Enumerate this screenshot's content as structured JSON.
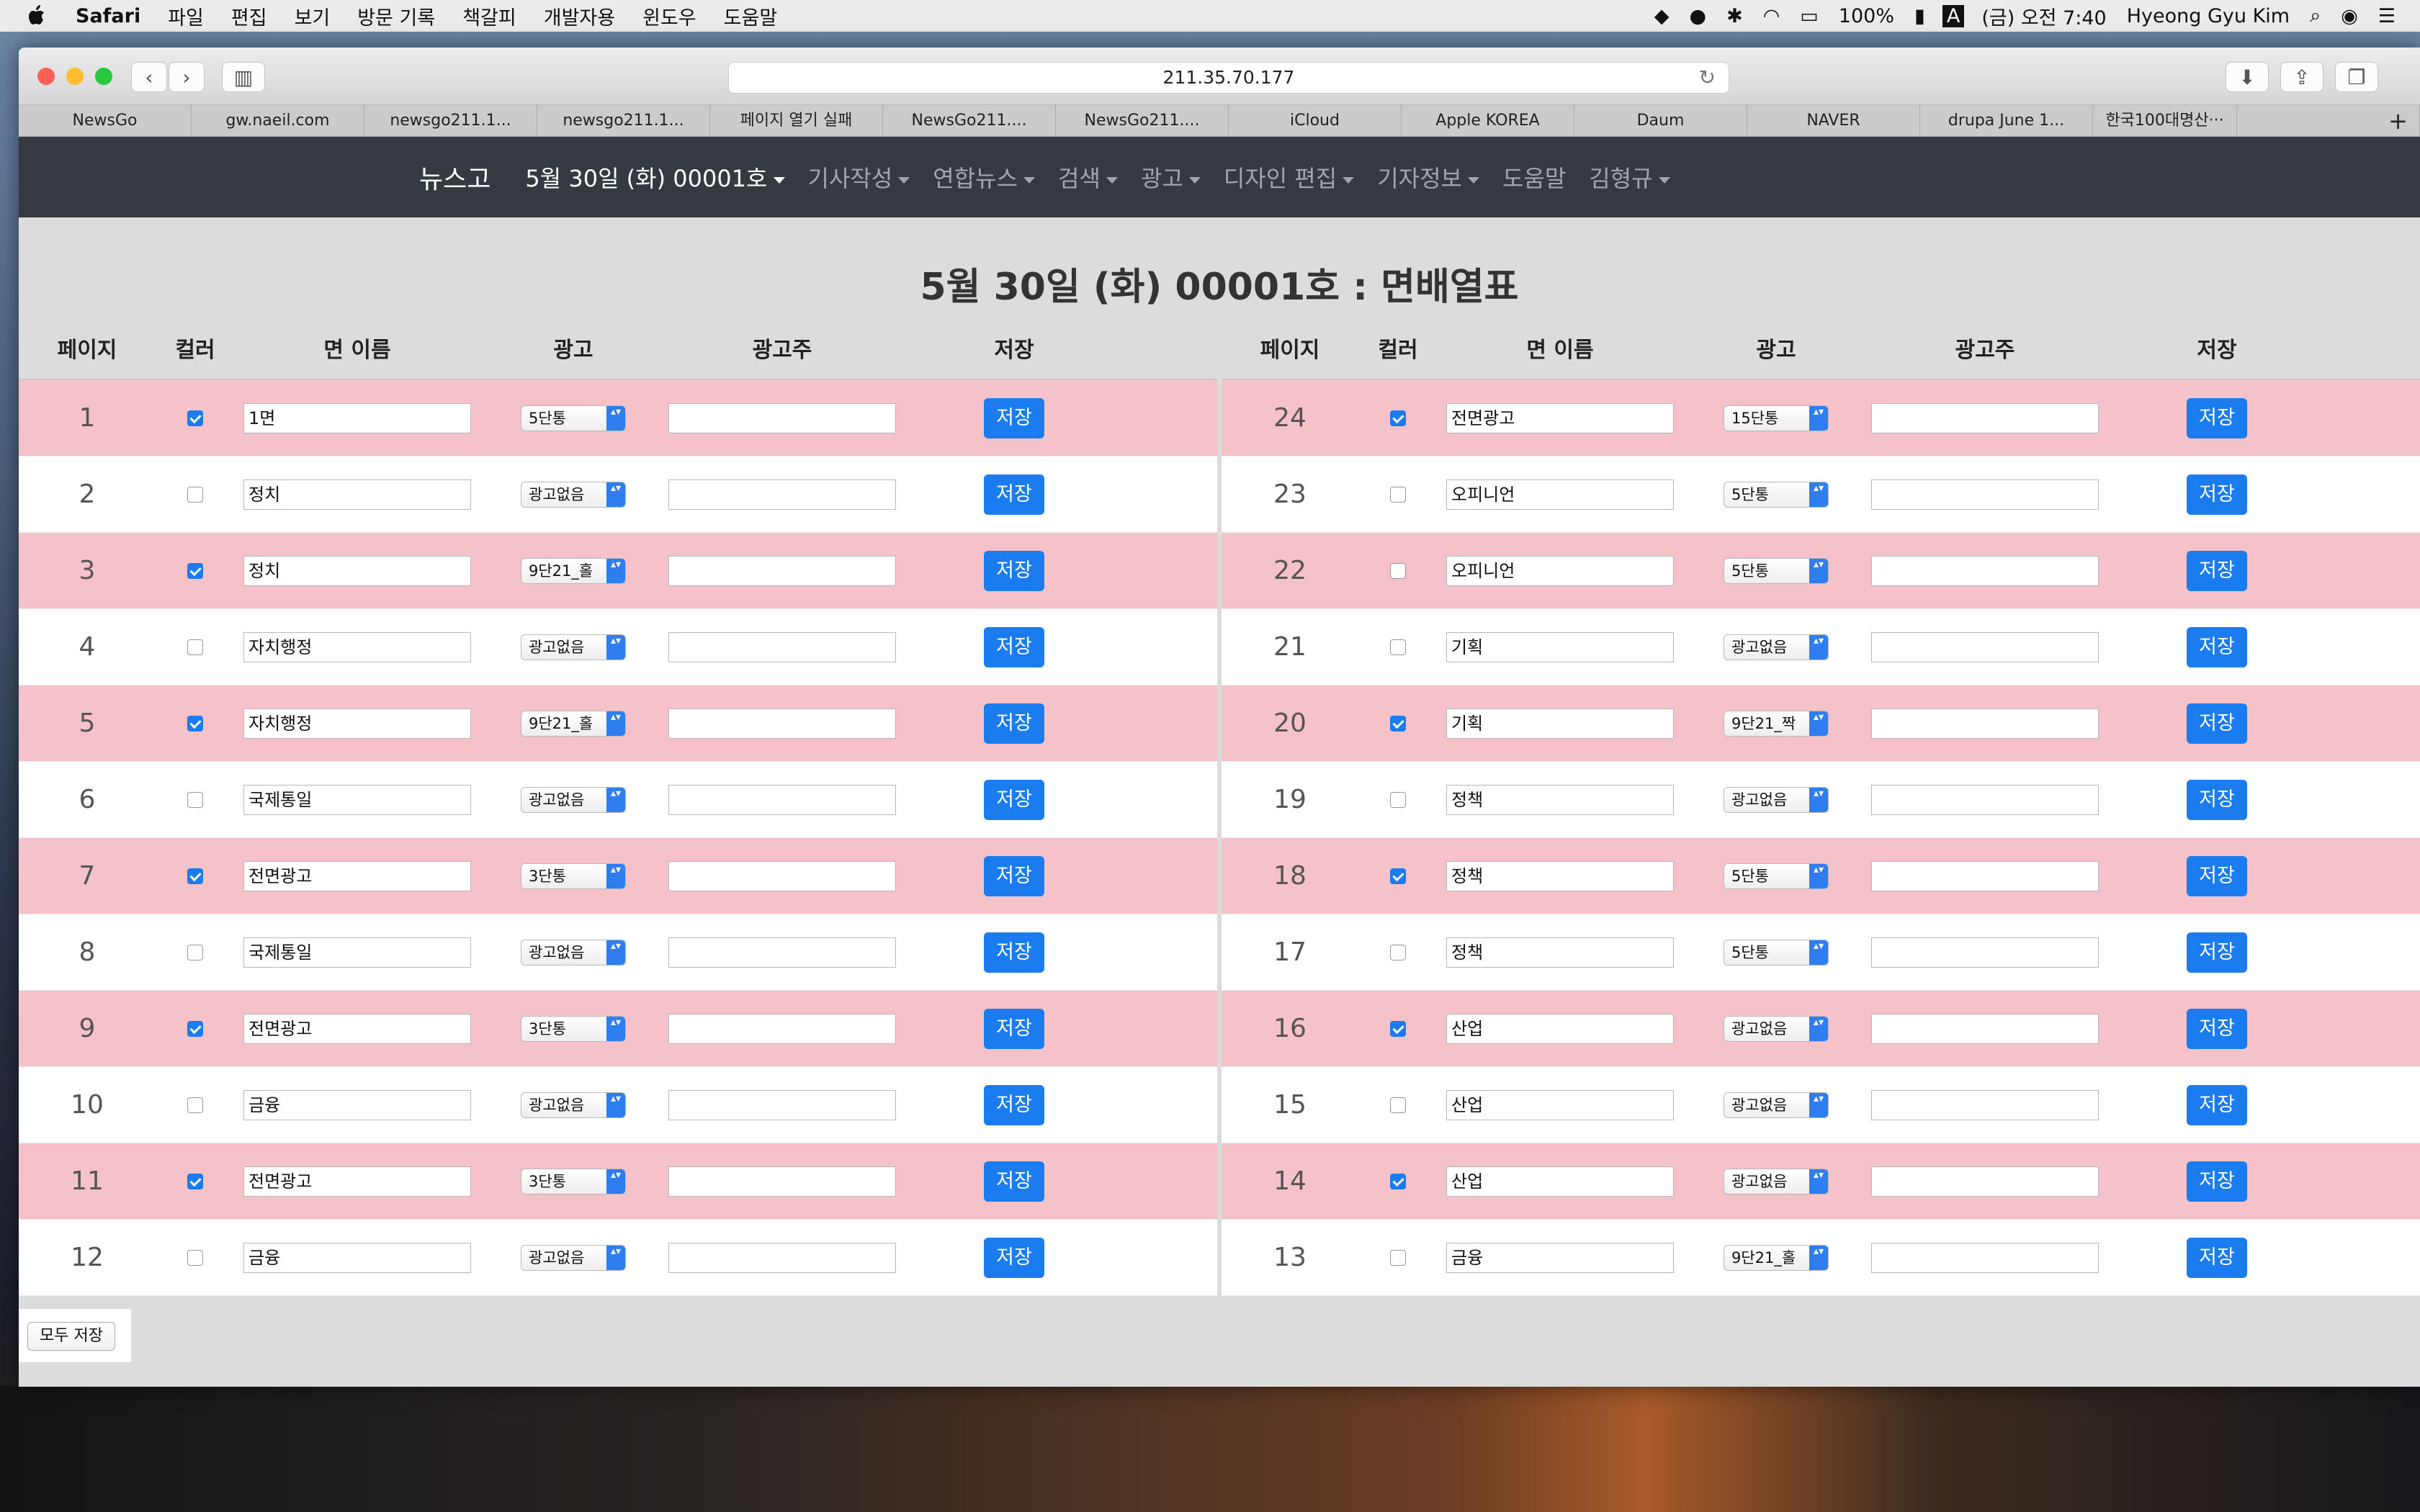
{
  "menubar": {
    "app": "Safari",
    "items": [
      "파일",
      "편집",
      "보기",
      "방문 기록",
      "책갈피",
      "개발자용",
      "윈도우",
      "도움말"
    ],
    "battery": "100%",
    "input": "A",
    "clock": "(금) 오전 7:40",
    "user": "Hyeong Gyu Kim"
  },
  "browser": {
    "url": "211.35.70.177",
    "tabs": [
      "NewsGo",
      "gw.naeil.com",
      "newsgo211.1...",
      "newsgo211.1...",
      "페이지 열기 실패",
      "NewsGo211....",
      "NewsGo211....",
      "iCloud",
      "Apple KOREA",
      "Daum",
      "NAVER",
      "drupa June 1...",
      "한국100대명산···"
    ]
  },
  "nav": {
    "brand": "뉴스고",
    "items": [
      "5월 30일 (화) 00001호",
      "기사작성",
      "연합뉴스",
      "검색",
      "광고",
      "디자인 편집",
      "기자정보",
      "도움말",
      "김형규"
    ]
  },
  "page": {
    "title": "5월 30일 (화) 00001호 : 면배열표",
    "save_all": "모두 저장"
  },
  "table": {
    "headers": [
      "페이지",
      "컬러",
      "면 이름",
      "광고",
      "광고주",
      "저장"
    ],
    "save_label": "저장",
    "left": [
      {
        "page": "1",
        "color": true,
        "name": "1면",
        "ad": "5단통"
      },
      {
        "page": "2",
        "color": false,
        "name": "정치",
        "ad": "광고없음"
      },
      {
        "page": "3",
        "color": true,
        "name": "정치",
        "ad": "9단21_홀"
      },
      {
        "page": "4",
        "color": false,
        "name": "자치행정",
        "ad": "광고없음"
      },
      {
        "page": "5",
        "color": true,
        "name": "자치행정",
        "ad": "9단21_홀"
      },
      {
        "page": "6",
        "color": false,
        "name": "국제통일",
        "ad": "광고없음"
      },
      {
        "page": "7",
        "color": true,
        "name": "전면광고",
        "ad": "3단통"
      },
      {
        "page": "8",
        "color": false,
        "name": "국제통일",
        "ad": "광고없음"
      },
      {
        "page": "9",
        "color": true,
        "name": "전면광고",
        "ad": "3단통"
      },
      {
        "page": "10",
        "color": false,
        "name": "금융",
        "ad": "광고없음"
      },
      {
        "page": "11",
        "color": true,
        "name": "전면광고",
        "ad": "3단통"
      },
      {
        "page": "12",
        "color": false,
        "name": "금융",
        "ad": "광고없음"
      }
    ],
    "right": [
      {
        "page": "24",
        "color": true,
        "name": "전면광고",
        "ad": "15단통"
      },
      {
        "page": "23",
        "color": false,
        "name": "오피니언",
        "ad": "5단통"
      },
      {
        "page": "22",
        "color": false,
        "name": "오피니언",
        "ad": "5단통"
      },
      {
        "page": "21",
        "color": false,
        "name": "기획",
        "ad": "광고없음"
      },
      {
        "page": "20",
        "color": true,
        "name": "기획",
        "ad": "9단21_짝"
      },
      {
        "page": "19",
        "color": false,
        "name": "정책",
        "ad": "광고없음"
      },
      {
        "page": "18",
        "color": true,
        "name": "정책",
        "ad": "5단통"
      },
      {
        "page": "17",
        "color": false,
        "name": "정책",
        "ad": "5단통"
      },
      {
        "page": "16",
        "color": true,
        "name": "산업",
        "ad": "광고없음"
      },
      {
        "page": "15",
        "color": false,
        "name": "산업",
        "ad": "광고없음"
      },
      {
        "page": "14",
        "color": true,
        "name": "산업",
        "ad": "광고없음"
      },
      {
        "page": "13",
        "color": false,
        "name": "금융",
        "ad": "9단21_홀"
      }
    ]
  },
  "colors": {
    "pink_row": "#f4c2c8",
    "button": "#1b7cf0",
    "navbar": "#343a40"
  }
}
